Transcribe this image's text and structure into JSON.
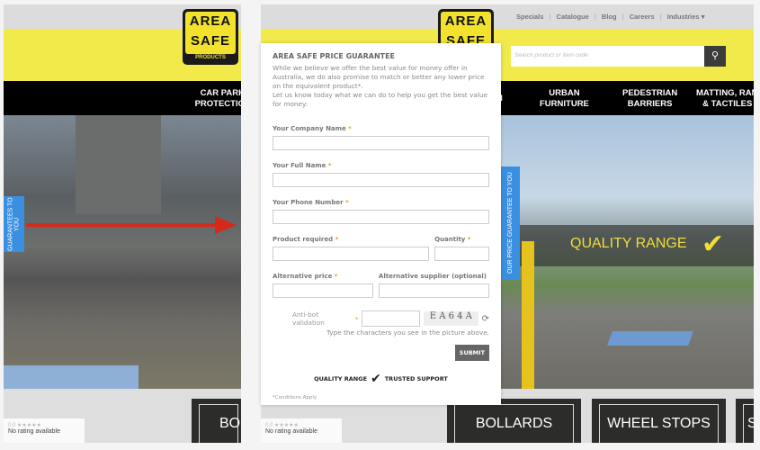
{
  "logo": {
    "line1": "AREA",
    "line2": "SAFE",
    "line3": "PRODUCTS"
  },
  "left": {
    "nav": [
      "CAR PARK\nPROTECTIO"
    ],
    "side_tab": "GUARANTEES TO YOU",
    "rating": {
      "score": "0.0 ★★★★★",
      "text": "No rating available"
    },
    "tile": "BO"
  },
  "right": {
    "top_links": [
      "Specials",
      "Catalogue",
      "Blog",
      "Careers",
      "Industries ▾"
    ],
    "search_placeholder": "Search product or item code",
    "search_icon": "search-icon",
    "nav": [
      "N",
      "URBAN\nFURNITURE",
      "PEDESTRIAN\nBARRIERS",
      "MATTING, RAM\n& TACTILES"
    ],
    "side_tab": "OUR PRICE GUARANTEE TO YOU",
    "banner": "QUALITY RANGE",
    "rating": {
      "score": "0.0 ★★★★★",
      "text": "No rating available"
    },
    "tiles": [
      "BOLLARDS",
      "WHEEL STOPS",
      "S"
    ]
  },
  "modal": {
    "title": "AREA SAFE PRICE GUARANTEE",
    "intro": "While we believe we offer the best value for money offer in Australia, we do also promise to match or better any lower price on the equivalent product*.",
    "intro2": "Let us know today what we can do to help you get the best value for money:",
    "fields": {
      "company": "Your Company Name",
      "name": "Your Full Name",
      "phone": "Your Phone Number",
      "product": "Product required",
      "quantity": "Quantity",
      "alt_price": "Alternative price",
      "alt_supplier": "Alternative supplier (optional)"
    },
    "required": "*",
    "antibot": "Anti-bot validation",
    "captcha": "E A 6 4 A",
    "captcha_hint": "Type the characters you see in the picture above.",
    "submit": "SUBMIT",
    "badge_left": "QUALITY RANGE",
    "badge_right": "TRUSTED SUPPORT",
    "conditions": "*Conditions Apply"
  }
}
